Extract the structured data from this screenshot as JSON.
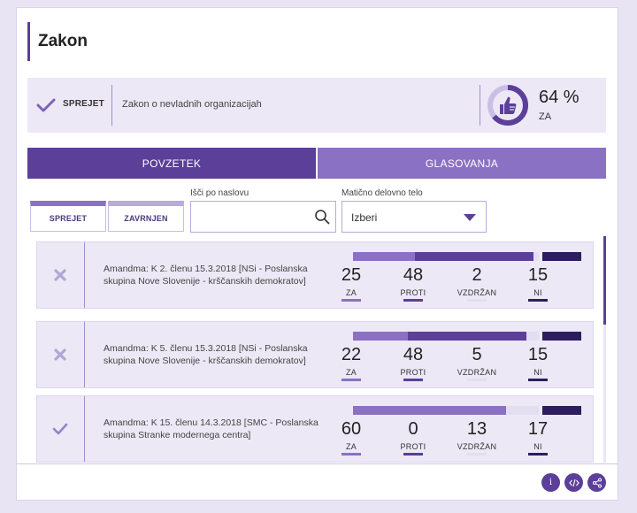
{
  "page": {
    "title": "Zakon"
  },
  "summary": {
    "status": "SPREJET",
    "law_name": "Zakon o nevladnih organizacijah",
    "percent_text": "64 %",
    "percent_value": 64,
    "percent_label": "ZA",
    "icons": [
      "check-icon",
      "thumbs-up-icon"
    ]
  },
  "tabs": [
    {
      "label": "POVZETEK",
      "active": true
    },
    {
      "label": "GLASOVANJA",
      "active": false
    }
  ],
  "filters": {
    "buttons": [
      "SPREJET",
      "ZAVRNJEN"
    ],
    "search_label": "Išči po naslovu",
    "search_value": "",
    "body_label": "Matično delovno telo",
    "body_value": "Izberi"
  },
  "colors": {
    "za": "#8a71c3",
    "proti": "#5b3f99",
    "vzdrzan": "#e3def0",
    "ni": "#2d1d5e"
  },
  "vote_labels": {
    "za": "ZA",
    "proti": "PROTI",
    "vzdrzan": "VZDRŽAN",
    "ni": "NI"
  },
  "items": [
    {
      "result": "rejected",
      "icon": "cross-icon",
      "text": "Amandma: K 2. členu 15.3.2018 [NSi - Poslanska skupina Nove Slovenije - krščanskih demokratov]",
      "za": 25,
      "proti": 48,
      "vzdrzan": 2,
      "ni": 15
    },
    {
      "result": "rejected",
      "icon": "cross-icon",
      "text": "Amandma: K 5. členu 15.3.2018 [NSi - Poslanska skupina Nove Slovenije - krščanskih demokratov]",
      "za": 22,
      "proti": 48,
      "vzdrzan": 5,
      "ni": 15
    },
    {
      "result": "accepted",
      "icon": "check-icon",
      "text": "Amandma: K 15. členu 14.3.2018 [SMC - Poslanska skupina Stranke modernega centra]",
      "za": 60,
      "proti": 0,
      "vzdrzan": 13,
      "ni": 17
    }
  ],
  "footer": {
    "info_symbol": "i",
    "embed_icon": "code-icon",
    "share_icon": "share-icon"
  }
}
